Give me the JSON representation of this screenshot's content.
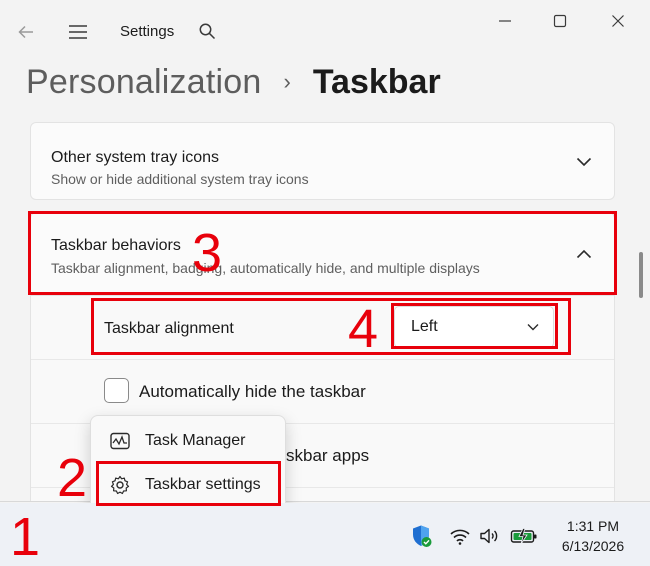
{
  "window": {
    "app_title": "Settings",
    "icons": {
      "back": "back-arrow-icon",
      "menu": "hamburger-menu-icon",
      "search": "search-icon",
      "minimize": "minimize-icon",
      "maximize": "maximize-icon",
      "close": "close-icon"
    }
  },
  "breadcrumb": {
    "parent": "Personalization",
    "separator": "›",
    "current": "Taskbar"
  },
  "sections": {
    "tray": {
      "title": "Other system tray icons",
      "subtitle": "Show or hide additional system tray icons"
    },
    "behaviors": {
      "title": "Taskbar behaviors",
      "subtitle": "Taskbar alignment, badging, automatically hide, and multiple displays"
    }
  },
  "settings": {
    "alignment_label": "Taskbar alignment",
    "alignment_value": "Left",
    "autohide_label": "Automatically hide the taskbar",
    "autohide_checked": false,
    "badges_label_partial": "skbar apps"
  },
  "context_menu": {
    "items": [
      {
        "label": "Task Manager",
        "icon": "task-manager-icon"
      },
      {
        "label": "Taskbar settings",
        "icon": "gear-icon"
      }
    ]
  },
  "taskbar": {
    "time": "1:31 PM",
    "date": "6/13/2026"
  },
  "annotations": {
    "n1": "1",
    "n2": "2",
    "n3": "3",
    "n4": "4",
    "color": "#e8000b"
  }
}
